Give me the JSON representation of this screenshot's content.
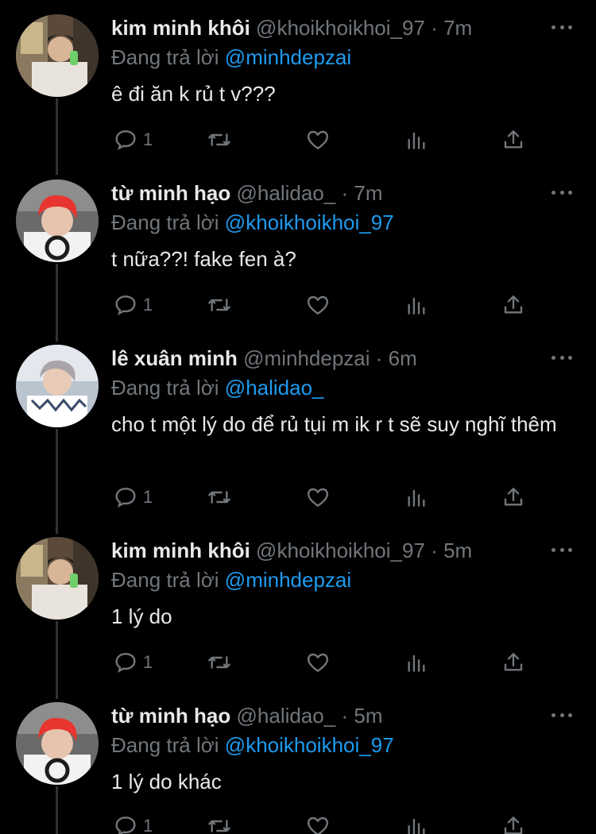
{
  "replying_prefix": "Đang trả lời",
  "colors": {
    "background": "#000000",
    "text": "#e7e9ea",
    "muted": "#71767b",
    "accent": "#1d9bf0",
    "thread_line": "#2f3336"
  },
  "tweets": [
    {
      "name": "kim minh khôi",
      "handle": "@khoikhoikhoi_97",
      "dot": "·",
      "time": "7m",
      "replying_to": "@minhdepzai",
      "text": "ê đi ăn k rủ t v???",
      "reply_count": "1",
      "avatar": "avatar-khoi"
    },
    {
      "name": "từ minh hạo",
      "handle": "@halidao_",
      "dot": "·",
      "time": "7m",
      "replying_to": "@khoikhoikhoi_97",
      "text": "t nữa??! fake fen à?",
      "reply_count": "1",
      "avatar": "avatar-hao"
    },
    {
      "name": "lê xuân minh",
      "handle": "@minhdepzai",
      "dot": "·",
      "time": "6m",
      "replying_to": "@halidao_",
      "text": "cho t một lý do để rủ tụi m ik r t sẽ suy nghĩ thêm",
      "reply_count": "1",
      "avatar": "avatar-minh"
    },
    {
      "name": "kim minh khôi",
      "handle": "@khoikhoikhoi_97",
      "dot": "·",
      "time": "5m",
      "replying_to": "@minhdepzai",
      "text": "1 lý do",
      "reply_count": "1",
      "avatar": "avatar-khoi"
    },
    {
      "name": "từ minh hạo",
      "handle": "@halidao_",
      "dot": "·",
      "time": "5m",
      "replying_to": "@khoikhoikhoi_97",
      "text": "1 lý do khác",
      "reply_count": "1",
      "avatar": "avatar-hao"
    }
  ]
}
